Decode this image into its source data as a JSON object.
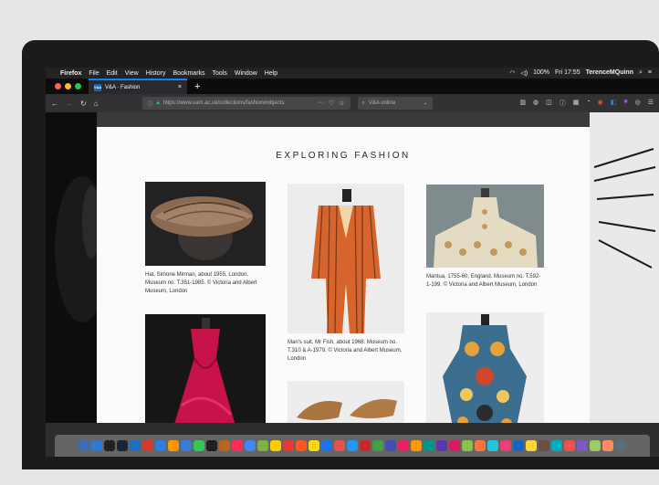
{
  "menubar": {
    "app_name": "Firefox",
    "items": [
      "File",
      "Edit",
      "View",
      "History",
      "Bookmarks",
      "Tools",
      "Window",
      "Help"
    ],
    "battery": "100%",
    "clock": "Fri 17:55",
    "user": "TerenceMQuinn"
  },
  "tab": {
    "favicon_text": "V&A",
    "title": "V&A · Fashion",
    "close_glyph": "×",
    "new_tab_glyph": "+"
  },
  "nav": {
    "back_glyph": "←",
    "forward_glyph": "→",
    "reload_glyph": "↻",
    "home_glyph": "⌂",
    "url": "https://www.vam.ac.uk/collections/fashion#objects",
    "page_actions_glyph": "···",
    "search_placeholder": "V&A online",
    "search_go_glyph": "→"
  },
  "page": {
    "title": "EXPLORING FASHION",
    "objects": [
      {
        "name": "hat",
        "caption": "Hat, Simone Mirman, about 1955, London. Museum no. T.351-1985. © Victoria and Albert Museum, London"
      },
      {
        "name": "suit",
        "caption": "Man's suit, Mr Fish, about 1968. Museum no. T.310 & A-1979. © Victoria and Albert Museum, London"
      },
      {
        "name": "mantua",
        "caption": "Mantua, 1755-60, England. Museum no. T.592-1-199. © Victoria and Albert Museum, London"
      },
      {
        "name": "pink-gown",
        "caption": ""
      },
      {
        "name": "shoes",
        "caption": ""
      },
      {
        "name": "printed-dress",
        "caption": ""
      }
    ]
  },
  "colors": {
    "accent": "#0a84ff",
    "page_bg": "#fbfbfb",
    "chrome_dark": "#0c0c0d",
    "lock_green": "#2ac769"
  },
  "icons": {
    "apple": "apple-logo-icon",
    "lock": "lock-icon",
    "bookmark": "star-icon",
    "pocket": "pocket-icon"
  },
  "dock": {
    "apps": [
      "#3a6fb5",
      "#2f79d1",
      "#222222",
      "#1b2438",
      "#1f6fbf",
      "#d33a2c",
      "#2f7de1",
      "#ff9500",
      "#3a7bd5",
      "#34c759",
      "#1e1e1e",
      "#b5651d",
      "#ff2d55",
      "#4285f4",
      "#7cb342",
      "#ffcc00",
      "#e53935",
      "#ff5722",
      "#ffd60a",
      "#1a73e8",
      "#e0554d",
      "#2196f3",
      "#c62828",
      "#43a047",
      "#3f51b5",
      "#e91e63",
      "#ff9800",
      "#009688",
      "#5e35b1",
      "#d81b60",
      "#8bc34a",
      "#ff7043",
      "#26c6da",
      "#ec407a",
      "#1565c0",
      "#fdd835",
      "#6d4c41",
      "#00acc1",
      "#ef5350",
      "#7e57c2",
      "#9ccc65",
      "#ff8a65",
      "#546e7a"
    ]
  }
}
